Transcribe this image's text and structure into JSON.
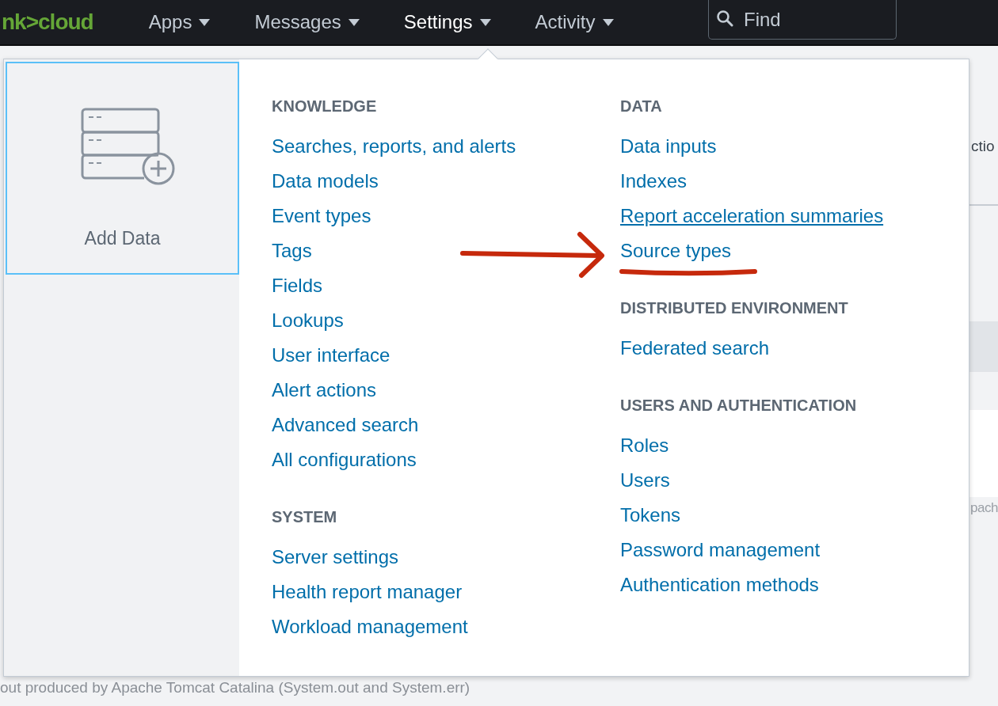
{
  "topbar": {
    "logo": "nk>cloud",
    "nav": [
      {
        "label": "Apps",
        "expanded": false
      },
      {
        "label": "Messages",
        "expanded": false
      },
      {
        "label": "Settings",
        "expanded": true
      },
      {
        "label": "Activity",
        "expanded": false
      }
    ],
    "search": {
      "placeholder": "Find"
    }
  },
  "background": {
    "fragments": [
      {
        "text": "ctio",
        "kind": "heading"
      },
      {
        "text": "pach",
        "kind": "muted"
      }
    ],
    "footer_text": "out produced by Apache Tomcat Catalina (System.out and System.err)"
  },
  "settings_menu": {
    "tile": {
      "label": "Add Data",
      "selected": true
    },
    "columns": [
      [
        {
          "heading": "KNOWLEDGE",
          "links": [
            {
              "label": "Searches, reports, and alerts",
              "underlined": false
            },
            {
              "label": "Data models",
              "underlined": false
            },
            {
              "label": "Event types",
              "underlined": false
            },
            {
              "label": "Tags",
              "underlined": false
            },
            {
              "label": "Fields",
              "underlined": false
            },
            {
              "label": "Lookups",
              "underlined": false
            },
            {
              "label": "User interface",
              "underlined": false
            },
            {
              "label": "Alert actions",
              "underlined": false
            },
            {
              "label": "Advanced search",
              "underlined": false
            },
            {
              "label": "All configurations",
              "underlined": false
            }
          ]
        },
        {
          "heading": "SYSTEM",
          "links": [
            {
              "label": "Server settings",
              "underlined": false
            },
            {
              "label": "Health report manager",
              "underlined": false
            },
            {
              "label": "Workload management",
              "underlined": false
            }
          ]
        }
      ],
      [
        {
          "heading": "DATA",
          "links": [
            {
              "label": "Data inputs",
              "underlined": false
            },
            {
              "label": "Indexes",
              "underlined": false
            },
            {
              "label": "Report acceleration summaries",
              "underlined": true
            },
            {
              "label": "Source types",
              "underlined": false
            }
          ]
        },
        {
          "heading": "DISTRIBUTED ENVIRONMENT",
          "links": [
            {
              "label": "Federated search",
              "underlined": false
            }
          ]
        },
        {
          "heading": "USERS AND AUTHENTICATION",
          "links": [
            {
              "label": "Roles",
              "underlined": false
            },
            {
              "label": "Users",
              "underlined": false
            },
            {
              "label": "Tokens",
              "underlined": false
            },
            {
              "label": "Password management",
              "underlined": false
            },
            {
              "label": "Authentication methods",
              "underlined": false
            }
          ]
        }
      ]
    ]
  }
}
